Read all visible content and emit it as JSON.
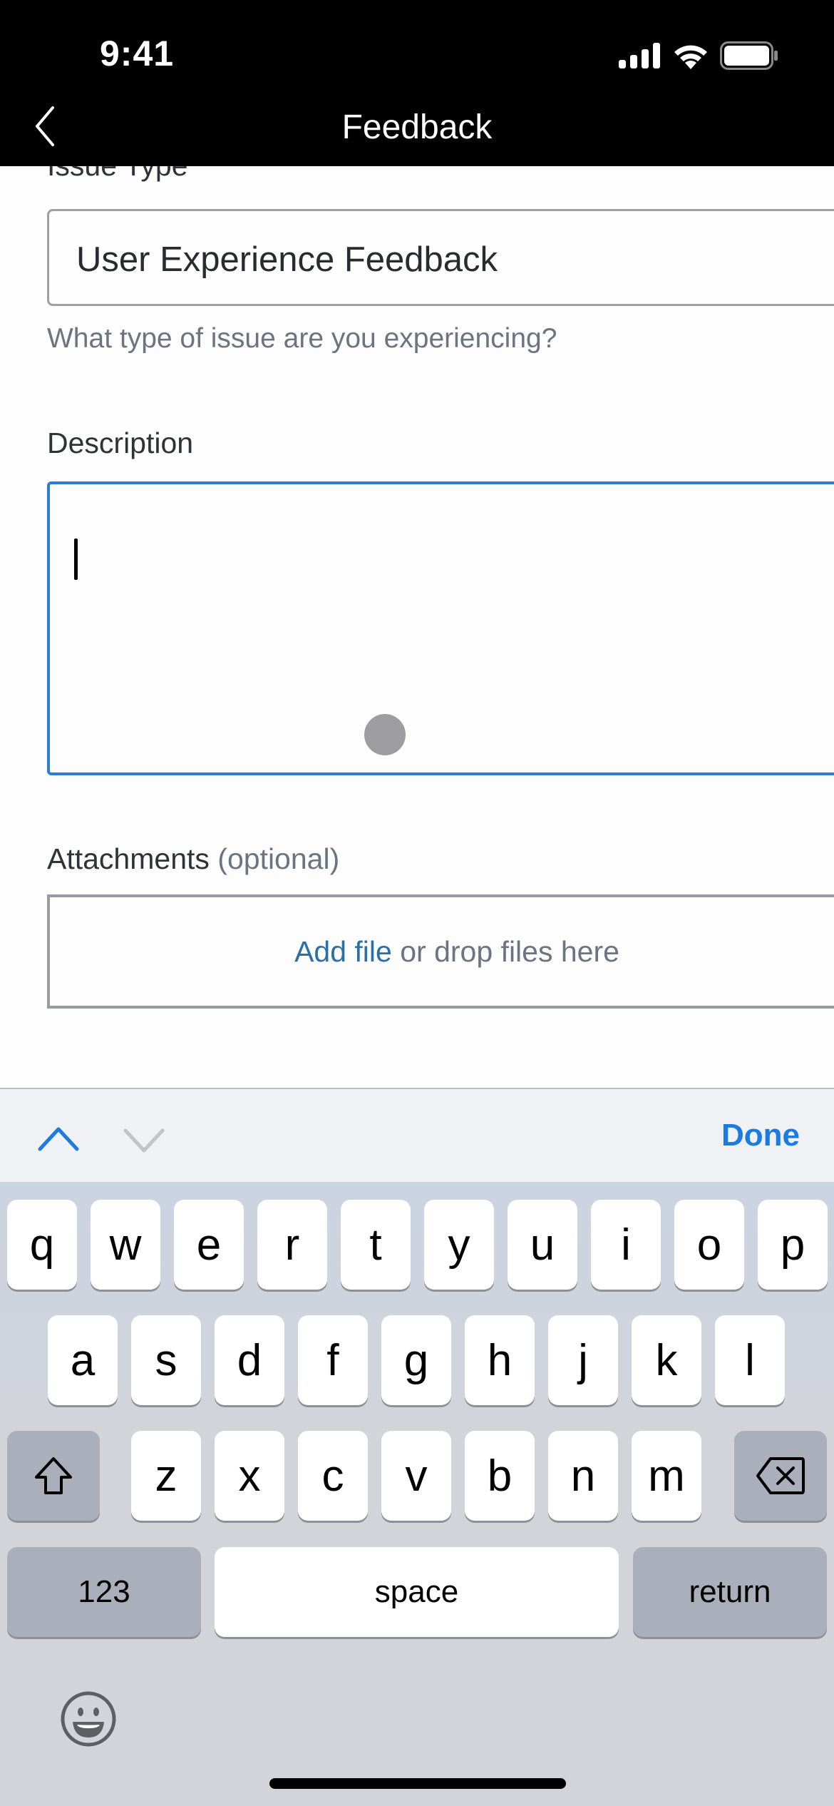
{
  "status_bar": {
    "time": "9:41",
    "icons": [
      "cellular-signal-icon",
      "wifi-icon",
      "battery-icon"
    ]
  },
  "nav": {
    "title": "Feedback",
    "back_icon": "chevron-left-icon"
  },
  "form": {
    "issue_type": {
      "label": "Issue Type",
      "value": "User Experience Feedback",
      "helper": "What type of issue are you experiencing?"
    },
    "description": {
      "label": "Description",
      "value": ""
    },
    "attachments": {
      "label": "Attachments",
      "optional": "(optional)",
      "add_link": "Add file",
      "drop_text": "or drop files here"
    }
  },
  "keyboard_toolbar": {
    "done_label": "Done",
    "prev_icon": "chevron-up-icon",
    "next_icon": "chevron-down-icon"
  },
  "keyboard": {
    "row1": [
      "q",
      "w",
      "e",
      "r",
      "t",
      "y",
      "u",
      "i",
      "o",
      "p"
    ],
    "row2": [
      "a",
      "s",
      "d",
      "f",
      "g",
      "h",
      "j",
      "k",
      "l"
    ],
    "row3": [
      "z",
      "x",
      "c",
      "v",
      "b",
      "n",
      "m"
    ],
    "numbers_label": "123",
    "space_label": "space",
    "return_label": "return",
    "shift_icon": "shift-icon",
    "delete_icon": "backspace-icon",
    "emoji_icon": "emoji-icon"
  },
  "colors": {
    "accent": "#2d7dd2",
    "link": "#2b6fa8",
    "done": "#1a7be0",
    "helper_text": "#6b7480"
  }
}
